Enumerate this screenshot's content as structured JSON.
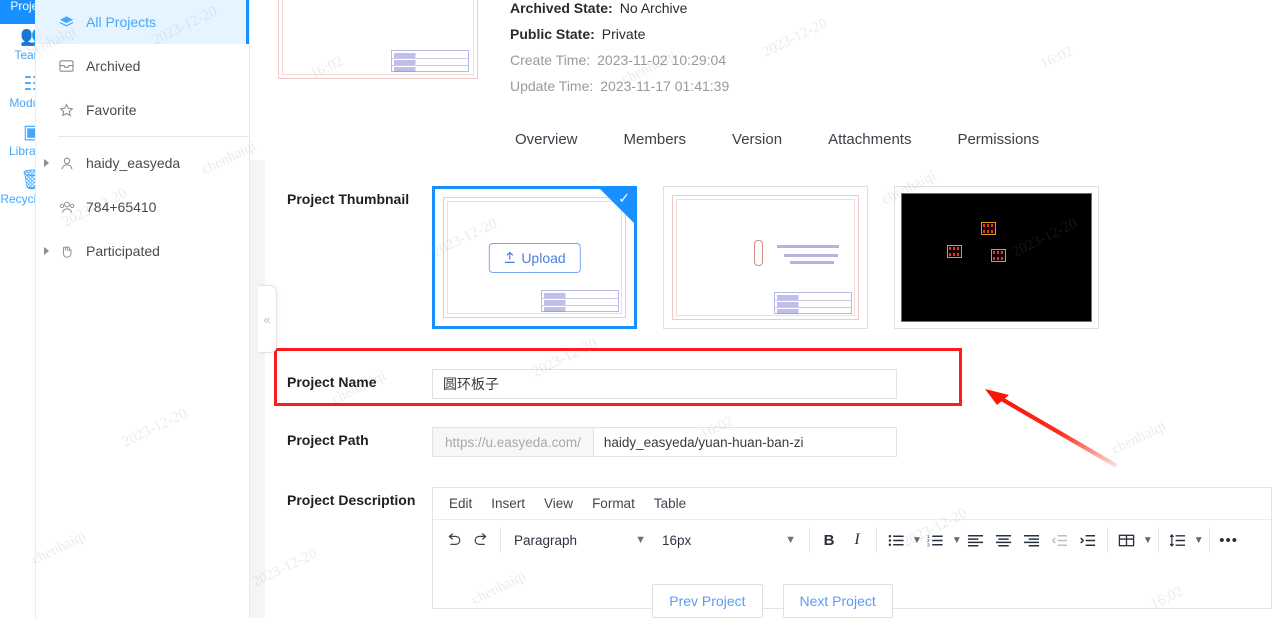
{
  "rail": {
    "items": [
      {
        "label": "Projects",
        "icon": "layers-icon",
        "active": true
      },
      {
        "label": "Teams",
        "icon": "team-icon",
        "active": false
      },
      {
        "label": "Modules",
        "icon": "modules-icon",
        "active": false
      },
      {
        "label": "Libraries",
        "icon": "chip-icon",
        "active": false
      },
      {
        "label": "Recycle Bin",
        "icon": "trash-icon",
        "active": false
      }
    ]
  },
  "sidebar": {
    "items": [
      {
        "label": "All Projects",
        "icon": "layers-icon",
        "active": true,
        "caret": false
      },
      {
        "label": "Archived",
        "icon": "archive-icon",
        "active": false,
        "caret": false
      },
      {
        "label": "Favorite",
        "icon": "star-icon",
        "active": false,
        "caret": false
      },
      {
        "label": "haidy_easyeda",
        "icon": "user-icon",
        "active": false,
        "caret": true
      },
      {
        "label": "784+65410",
        "icon": "group-icon",
        "active": false,
        "caret": false
      },
      {
        "label": "Participated",
        "icon": "hand-icon",
        "active": false,
        "caret": true
      }
    ],
    "collapse_glyph": "«"
  },
  "header": {
    "meta": [
      {
        "key": "Archived State:",
        "value": "No Archive",
        "dim": false
      },
      {
        "key": "Public State:",
        "value": "Private",
        "dim": false
      },
      {
        "key": "Create Time:",
        "value": "2023-11-02 10:29:04",
        "dim": true
      },
      {
        "key": "Update Time:",
        "value": "2023-11-17 01:41:39",
        "dim": true
      }
    ],
    "tabs": [
      {
        "label": "Overview"
      },
      {
        "label": "Members"
      },
      {
        "label": "Version"
      },
      {
        "label": "Attachments"
      },
      {
        "label": "Permissions"
      }
    ]
  },
  "form": {
    "thumbnail_label": "Project Thumbnail",
    "upload_label": "Upload",
    "upload_icon": "upload-arrow-icon",
    "check_glyph": "✓",
    "thumbnails": [
      {
        "kind": "schematic",
        "selected": true
      },
      {
        "kind": "schematic",
        "selected": false
      },
      {
        "kind": "pcb",
        "selected": false
      }
    ],
    "name_label": "Project Name",
    "name_value": "圆环板子",
    "path_label": "Project Path",
    "path_prefix": "https://u.easyeda.com/",
    "path_value": "haidy_easyeda/yuan-huan-ban-zi",
    "description_label": "Project Description"
  },
  "editor": {
    "menus": [
      "Edit",
      "Insert",
      "View",
      "Format",
      "Table"
    ],
    "undo_icon": "undo-icon",
    "redo_icon": "redo-icon",
    "block_format": "Paragraph",
    "font_size": "16px",
    "bold_label": "B",
    "italic_label": "I",
    "overflow_label": "•••",
    "tools": [
      {
        "name": "bullet-list-icon"
      },
      {
        "name": "numbered-list-icon"
      },
      {
        "name": "align-left-icon"
      },
      {
        "name": "align-center-icon"
      },
      {
        "name": "align-right-icon"
      },
      {
        "name": "outdent-icon"
      },
      {
        "name": "indent-icon"
      },
      {
        "name": "table-icon"
      },
      {
        "name": "line-height-icon"
      }
    ]
  },
  "footer": {
    "prev_label": "Prev Project",
    "next_label": "Next Project"
  },
  "annotation": {
    "arrow_color": "#fa1505"
  },
  "watermarks": [
    "chenhaiqi",
    "2023-12-20",
    "16:02"
  ],
  "colors": {
    "accent": "#1890ff",
    "accent_light": "#e6f4ff",
    "link": "#5b9bf8",
    "highlight": "#ff1b1b",
    "page_bg": "#f5f5f5"
  }
}
